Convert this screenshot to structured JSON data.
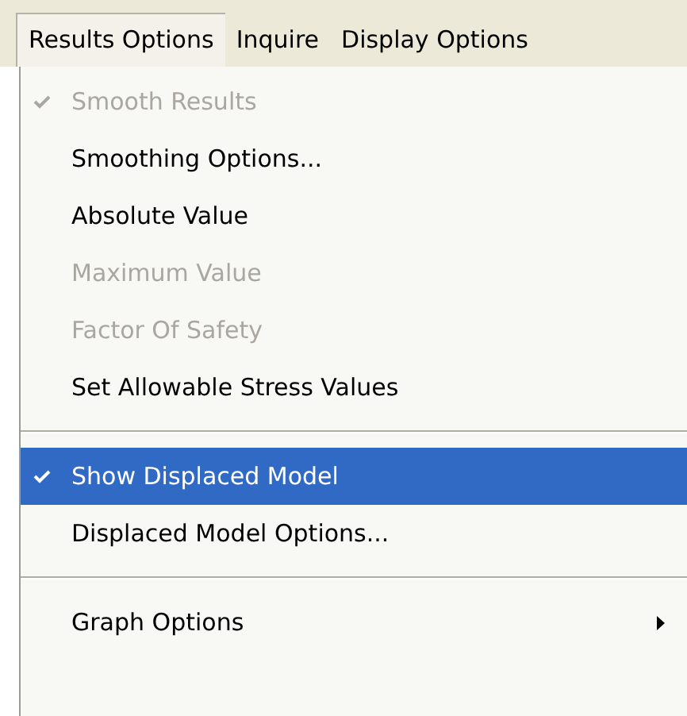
{
  "menu_bar": [
    {
      "label": "Results Options",
      "selected": true
    },
    {
      "label": "Inquire",
      "selected": false
    },
    {
      "label": "Display Options",
      "selected": false
    }
  ],
  "menu": [
    {
      "kind": "item",
      "label": "Smooth Results",
      "checked": true,
      "disabled": true,
      "selected": false,
      "submenu": false
    },
    {
      "kind": "item",
      "label": "Smoothing Options...",
      "checked": false,
      "disabled": false,
      "selected": false,
      "submenu": false
    },
    {
      "kind": "item",
      "label": "Absolute Value",
      "checked": false,
      "disabled": false,
      "selected": false,
      "submenu": false
    },
    {
      "kind": "item",
      "label": "Maximum Value",
      "checked": false,
      "disabled": true,
      "selected": false,
      "submenu": false
    },
    {
      "kind": "item",
      "label": "Factor Of Safety",
      "checked": false,
      "disabled": true,
      "selected": false,
      "submenu": false
    },
    {
      "kind": "item",
      "label": "Set Allowable Stress Values",
      "checked": false,
      "disabled": false,
      "selected": false,
      "submenu": false
    },
    {
      "kind": "separator"
    },
    {
      "kind": "item",
      "label": "Show Displaced Model",
      "checked": true,
      "disabled": false,
      "selected": true,
      "submenu": false
    },
    {
      "kind": "item",
      "label": "Displaced Model Options...",
      "checked": false,
      "disabled": false,
      "selected": false,
      "submenu": false
    },
    {
      "kind": "separator"
    },
    {
      "kind": "item",
      "label": "Graph Options",
      "checked": false,
      "disabled": false,
      "selected": false,
      "submenu": true
    }
  ]
}
